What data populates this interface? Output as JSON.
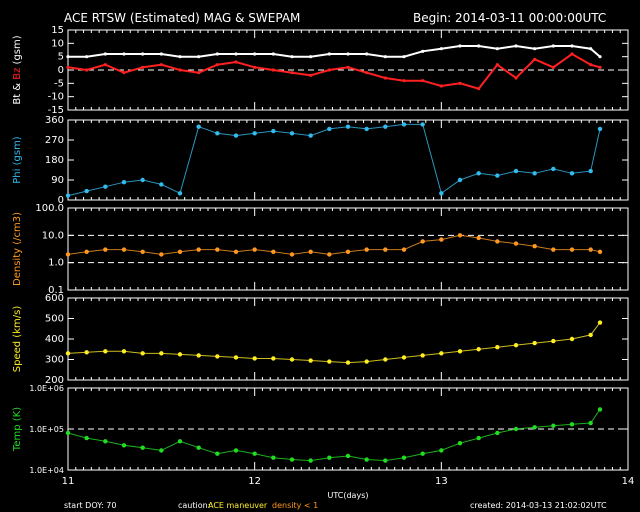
{
  "header": {
    "title": "ACE RTSW (Estimated) MAG & SWEPAM",
    "begin": "Begin: 2014-03-11 00:00:00UTC"
  },
  "footer": {
    "start_doy": "start DOY:  70",
    "caution_label": "caution:",
    "caution_maneuver": "ACE maneuver",
    "caution_density": "density < 1",
    "created": "created: 2014-03-13 21:02:02UTC"
  },
  "colors": {
    "background": "#000000",
    "axes": "#ffffff",
    "bt": "#ffffff",
    "bz": "#ff2020",
    "phi": "#33bbee",
    "density": "#ff9922",
    "speed": "#ffee22",
    "temp": "#22dd22",
    "caution_maneuver": "#ffee22",
    "caution_density": "#ff9922"
  },
  "chart_data": [
    {
      "type": "line",
      "panel": "mag",
      "ylabel_parts": [
        {
          "text": "Bt",
          "color": "#ffffff"
        },
        {
          "text": " & ",
          "color": "#ffffff"
        },
        {
          "text": "Bz",
          "color": "#ff2020"
        },
        {
          "text": " (gsm)",
          "color": "#ffffff"
        }
      ],
      "ylim": [
        -15,
        15
      ],
      "yticks": [
        -15,
        -10,
        -5,
        0,
        5,
        10,
        15
      ],
      "ytick_labels": [
        "-15",
        "-10",
        "-5",
        "0",
        "5",
        "10",
        "15"
      ],
      "reference_line": 0,
      "x": [
        11.0,
        11.1,
        11.2,
        11.3,
        11.4,
        11.5,
        11.6,
        11.7,
        11.8,
        11.9,
        12.0,
        12.1,
        12.2,
        12.3,
        12.4,
        12.5,
        12.6,
        12.7,
        12.8,
        12.9,
        13.0,
        13.1,
        13.2,
        13.3,
        13.4,
        13.5,
        13.6,
        13.7,
        13.8,
        13.85
      ],
      "series": [
        {
          "name": "Bt",
          "color": "#ffffff",
          "values": [
            5,
            5,
            6,
            6,
            6,
            6,
            5,
            5,
            6,
            6,
            6,
            6,
            5,
            5,
            6,
            6,
            6,
            5,
            5,
            7,
            8,
            9,
            9,
            8,
            9,
            8,
            9,
            9,
            8,
            5
          ]
        },
        {
          "name": "Bz",
          "color": "#ff2020",
          "values": [
            1,
            0,
            2,
            -1,
            1,
            2,
            0,
            -1,
            2,
            3,
            1,
            0,
            -1,
            -2,
            0,
            1,
            -1,
            -3,
            -4,
            -4,
            -6,
            -5,
            -7,
            2,
            -3,
            4,
            1,
            6,
            2,
            1
          ]
        }
      ]
    },
    {
      "type": "scatter",
      "panel": "phi",
      "ylabel": "Phi (gsm)",
      "ylim": [
        0,
        360
      ],
      "yticks": [
        0,
        90,
        180,
        270,
        360
      ],
      "ytick_labels": [
        "0",
        "90",
        "180",
        "270",
        "360"
      ],
      "x": [
        11.0,
        11.1,
        11.2,
        11.3,
        11.4,
        11.5,
        11.6,
        11.7,
        11.8,
        11.9,
        12.0,
        12.1,
        12.2,
        12.3,
        12.4,
        12.5,
        12.6,
        12.7,
        12.8,
        12.9,
        13.0,
        13.1,
        13.2,
        13.3,
        13.4,
        13.5,
        13.6,
        13.7,
        13.8,
        13.85
      ],
      "series": [
        {
          "name": "Phi",
          "color": "#33bbee",
          "values": [
            20,
            40,
            60,
            80,
            90,
            70,
            30,
            330,
            300,
            290,
            300,
            310,
            300,
            290,
            320,
            330,
            320,
            330,
            340,
            340,
            30,
            90,
            120,
            110,
            130,
            120,
            140,
            120,
            130,
            320
          ]
        }
      ]
    },
    {
      "type": "scatter",
      "panel": "density",
      "ylabel": "Density (/cm3)",
      "yscale": "log",
      "ylim": [
        0.1,
        100
      ],
      "yticks": [
        0.1,
        1,
        10,
        100
      ],
      "ytick_labels": [
        "0.1",
        "1.0",
        "10.0",
        "100.0"
      ],
      "reference_lines": [
        1,
        10
      ],
      "x": [
        11.0,
        11.1,
        11.2,
        11.3,
        11.4,
        11.5,
        11.6,
        11.7,
        11.8,
        11.9,
        12.0,
        12.1,
        12.2,
        12.3,
        12.4,
        12.5,
        12.6,
        12.7,
        12.8,
        12.9,
        13.0,
        13.1,
        13.2,
        13.3,
        13.4,
        13.5,
        13.6,
        13.7,
        13.8,
        13.85
      ],
      "series": [
        {
          "name": "Density",
          "color": "#ff9922",
          "values": [
            2,
            2.5,
            3,
            3,
            2.5,
            2,
            2.5,
            3,
            3,
            2.5,
            3,
            2.5,
            2,
            2.5,
            2,
            2.5,
            3,
            3,
            3,
            6,
            7,
            10,
            8,
            6,
            5,
            4,
            3,
            3,
            3,
            2.5
          ]
        }
      ]
    },
    {
      "type": "scatter",
      "panel": "speed",
      "ylabel": "Speed (km/s)",
      "ylim": [
        200,
        600
      ],
      "yticks": [
        200,
        300,
        400,
        500,
        600
      ],
      "ytick_labels": [
        "200",
        "300",
        "400",
        "500",
        "600"
      ],
      "x": [
        11.0,
        11.1,
        11.2,
        11.3,
        11.4,
        11.5,
        11.6,
        11.7,
        11.8,
        11.9,
        12.0,
        12.1,
        12.2,
        12.3,
        12.4,
        12.5,
        12.6,
        12.7,
        12.8,
        12.9,
        13.0,
        13.1,
        13.2,
        13.3,
        13.4,
        13.5,
        13.6,
        13.7,
        13.8,
        13.85
      ],
      "series": [
        {
          "name": "Speed",
          "color": "#ffee22",
          "values": [
            330,
            335,
            340,
            340,
            330,
            330,
            325,
            320,
            315,
            310,
            305,
            305,
            300,
            295,
            290,
            285,
            290,
            300,
            310,
            320,
            330,
            340,
            350,
            360,
            370,
            380,
            390,
            400,
            420,
            480
          ]
        }
      ]
    },
    {
      "type": "scatter",
      "panel": "temp",
      "ylabel": "Temp (K)",
      "yscale": "log",
      "ylim": [
        10000,
        1000000
      ],
      "yticks": [
        10000,
        100000,
        1000000
      ],
      "ytick_labels": [
        "1.0E+04",
        "1.0E+05",
        "1.0E+06"
      ],
      "reference_line": 100000,
      "x": [
        11.0,
        11.1,
        11.2,
        11.3,
        11.4,
        11.5,
        11.6,
        11.7,
        11.8,
        11.9,
        12.0,
        12.1,
        12.2,
        12.3,
        12.4,
        12.5,
        12.6,
        12.7,
        12.8,
        12.9,
        13.0,
        13.1,
        13.2,
        13.3,
        13.4,
        13.5,
        13.6,
        13.7,
        13.8,
        13.85
      ],
      "series": [
        {
          "name": "Temp",
          "color": "#22dd22",
          "values": [
            80000,
            60000,
            50000,
            40000,
            35000,
            30000,
            50000,
            35000,
            25000,
            30000,
            25000,
            20000,
            18000,
            17000,
            20000,
            22000,
            18000,
            17000,
            20000,
            25000,
            30000,
            45000,
            60000,
            80000,
            100000,
            110000,
            120000,
            130000,
            140000,
            300000
          ]
        }
      ]
    }
  ],
  "x_axis": {
    "xlim": [
      11,
      14
    ],
    "ticks": [
      11,
      12,
      13,
      14
    ],
    "tick_labels": [
      "11",
      "12",
      "13",
      "14"
    ],
    "label": "UTC(days)"
  }
}
